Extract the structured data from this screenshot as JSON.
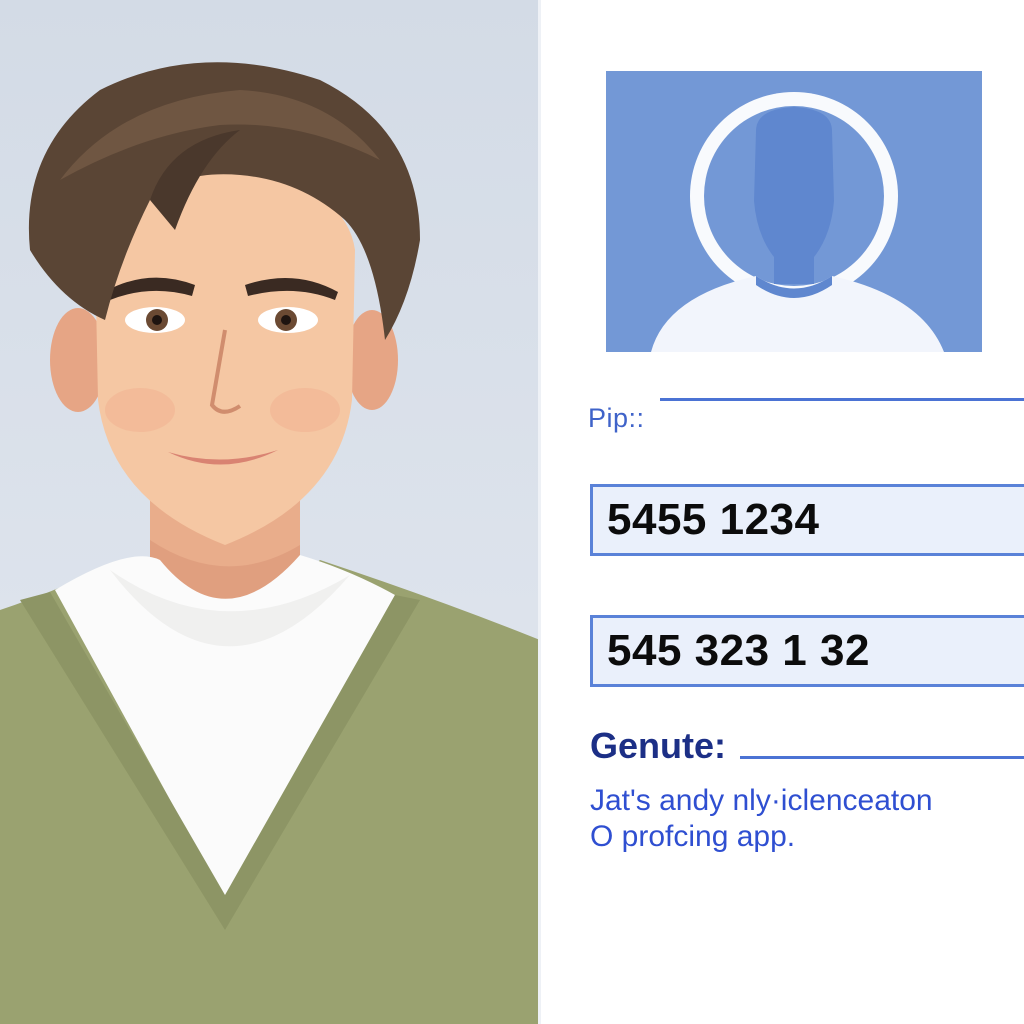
{
  "portrait": {
    "icon": "person-portrait"
  },
  "avatar": {
    "icon": "user-silhouette-icon",
    "background": "#7398d6"
  },
  "form": {
    "pip_label": "Pip::",
    "field_1_value": "5455 1234",
    "field_2_value": "545 323 1 32",
    "genute_label": "Genute:",
    "description_line_1": "Jat's andy nly·iclenceaton",
    "description_line_2": "O  profcing app."
  },
  "colors": {
    "accent": "#4b73d4",
    "field_background": "#eaf0fb",
    "label_dark": "#1c2f86",
    "link_blue": "#2f4fd1"
  }
}
